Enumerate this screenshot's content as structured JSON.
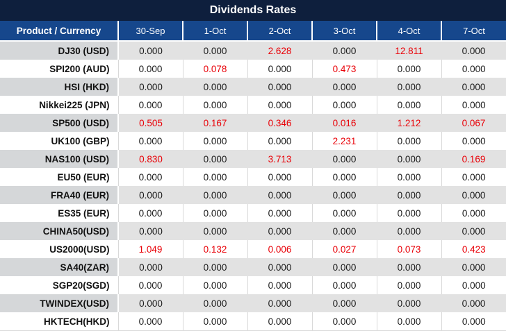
{
  "title": "Dividends Rates",
  "colors": {
    "title_bar_bg": "#0e1f3d",
    "header_bg": "#16478c",
    "header_text": "#ffffff",
    "row_gray_product_bg": "#d5d7d9",
    "row_gray_cell_bg": "#e2e2e2",
    "row_white_bg": "#ffffff",
    "divider": "#d9d9d9",
    "value_zero": "#1a1a1a",
    "value_nonzero": "#e90007",
    "product_text": "#111111"
  },
  "chart_data": {
    "type": "table",
    "title": "Dividends Rates",
    "columns": [
      "Product / Currency",
      "30-Sep",
      "1-Oct",
      "2-Oct",
      "3-Oct",
      "4-Oct",
      "7-Oct"
    ],
    "rows": [
      {
        "product": "DJ30 (USD)",
        "values": [
          "0.000",
          "0.000",
          "2.628",
          "0.000",
          "12.811",
          "0.000"
        ]
      },
      {
        "product": "SPI200 (AUD)",
        "values": [
          "0.000",
          "0.078",
          "0.000",
          "0.473",
          "0.000",
          "0.000"
        ]
      },
      {
        "product": "HSI (HKD)",
        "values": [
          "0.000",
          "0.000",
          "0.000",
          "0.000",
          "0.000",
          "0.000"
        ]
      },
      {
        "product": "Nikkei225 (JPN)",
        "values": [
          "0.000",
          "0.000",
          "0.000",
          "0.000",
          "0.000",
          "0.000"
        ]
      },
      {
        "product": "SP500 (USD)",
        "values": [
          "0.505",
          "0.167",
          "0.346",
          "0.016",
          "1.212",
          "0.067"
        ]
      },
      {
        "product": "UK100 (GBP)",
        "values": [
          "0.000",
          "0.000",
          "0.000",
          "2.231",
          "0.000",
          "0.000"
        ]
      },
      {
        "product": "NAS100 (USD)",
        "values": [
          "0.830",
          "0.000",
          "3.713",
          "0.000",
          "0.000",
          "0.169"
        ]
      },
      {
        "product": "EU50 (EUR)",
        "values": [
          "0.000",
          "0.000",
          "0.000",
          "0.000",
          "0.000",
          "0.000"
        ]
      },
      {
        "product": "FRA40 (EUR)",
        "values": [
          "0.000",
          "0.000",
          "0.000",
          "0.000",
          "0.000",
          "0.000"
        ]
      },
      {
        "product": "ES35 (EUR)",
        "values": [
          "0.000",
          "0.000",
          "0.000",
          "0.000",
          "0.000",
          "0.000"
        ]
      },
      {
        "product": "CHINA50(USD)",
        "values": [
          "0.000",
          "0.000",
          "0.000",
          "0.000",
          "0.000",
          "0.000"
        ]
      },
      {
        "product": "US2000(USD)",
        "values": [
          "1.049",
          "0.132",
          "0.006",
          "0.027",
          "0.073",
          "0.423"
        ]
      },
      {
        "product": "SA40(ZAR)",
        "values": [
          "0.000",
          "0.000",
          "0.000",
          "0.000",
          "0.000",
          "0.000"
        ]
      },
      {
        "product": "SGP20(SGD)",
        "values": [
          "0.000",
          "0.000",
          "0.000",
          "0.000",
          "0.000",
          "0.000"
        ]
      },
      {
        "product": "TWINDEX(USD)",
        "values": [
          "0.000",
          "0.000",
          "0.000",
          "0.000",
          "0.000",
          "0.000"
        ]
      },
      {
        "product": "HKTECH(HKD)",
        "values": [
          "0.000",
          "0.000",
          "0.000",
          "0.000",
          "0.000",
          "0.000"
        ]
      }
    ],
    "value_format": "3 decimal places",
    "highlight_rule": "non-zero dividend values rendered in red",
    "row_striping": "odd rows gray, even rows white"
  }
}
